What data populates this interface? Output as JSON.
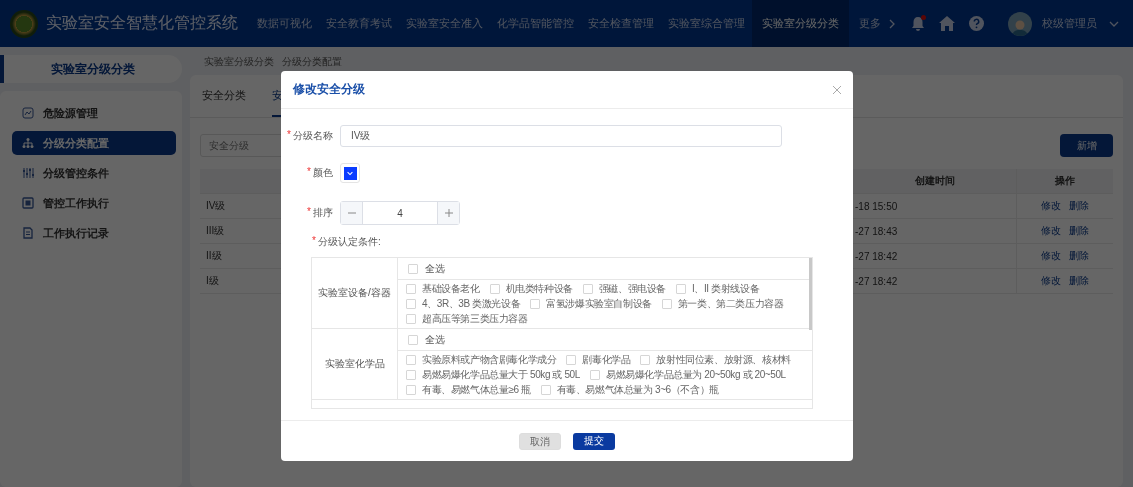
{
  "header": {
    "title": "实验室安全智慧化管控系统",
    "nav": [
      {
        "label": "数据可视化",
        "selected": false
      },
      {
        "label": "安全教育考试",
        "selected": false
      },
      {
        "label": "实验室安全准入",
        "selected": false
      },
      {
        "label": "化学品智能管控",
        "selected": false
      },
      {
        "label": "安全检查管理",
        "selected": false
      },
      {
        "label": "实验室综合管理",
        "selected": false
      },
      {
        "label": "实验室分级分类",
        "selected": true
      }
    ],
    "more": "更多",
    "notifications": true,
    "user": "校级管理员"
  },
  "sidebar": {
    "title": "实验室分级分类",
    "items": [
      {
        "label": "危险源管理",
        "selected": false
      },
      {
        "label": "分级分类配置",
        "selected": true
      },
      {
        "label": "分级管控条件",
        "selected": false
      },
      {
        "label": "管控工作执行",
        "selected": false
      },
      {
        "label": "工作执行记录",
        "selected": false
      }
    ]
  },
  "breadcrumb": [
    "实验室分级分类",
    "分级分类配置"
  ],
  "tabs": [
    {
      "label": "安全分类",
      "selected": false
    },
    {
      "label": "安",
      "selected": true
    }
  ],
  "search": {
    "placeholder": "安全分级"
  },
  "new_button": "新增",
  "table": {
    "columns": [
      "创建时间",
      "操作"
    ],
    "rows": [
      {
        "name": "IV级",
        "created": "-18 15:50",
        "actions": [
          "修改",
          "删除"
        ]
      },
      {
        "name": "III级",
        "created": "-27 18:43",
        "actions": [
          "修改",
          "删除"
        ]
      },
      {
        "name": "II级",
        "created": "-27 18:42",
        "actions": [
          "修改",
          "删除"
        ]
      },
      {
        "name": "I级",
        "created": "-27 18:42",
        "actions": [
          "修改",
          "删除"
        ]
      }
    ]
  },
  "dialog": {
    "title": "修改安全分级",
    "fields": [
      {
        "kind": "text",
        "required_mark": "*",
        "label": "分级名称",
        "value": "IV级"
      },
      {
        "kind": "color",
        "required_mark": "*",
        "label": "颜色",
        "color": "#0a3cff"
      },
      {
        "kind": "stepper",
        "required_mark": "*",
        "label": "排序",
        "value": "4"
      }
    ],
    "conditions": {
      "required_mark": "*",
      "label": "分级认定条件:",
      "groups": [
        {
          "name": "实验室设备/容器",
          "select_all": {
            "label": "全选",
            "checked": false
          },
          "items": [
            {
              "label": "基础设备老化",
              "checked": false
            },
            {
              "label": "机电类特种设备",
              "checked": false
            },
            {
              "label": "强磁、强电设备",
              "checked": false
            },
            {
              "label": "I、II 类射线设备",
              "checked": false
            },
            {
              "label": "4、3R、3B 类激光设备",
              "checked": false
            },
            {
              "label": "富氢涉爆实验室自制设备",
              "checked": false
            },
            {
              "label": "第一类、第二类压力容器",
              "checked": false
            },
            {
              "label": "超高压等第三类压力容器",
              "checked": false
            }
          ]
        },
        {
          "name": "实验室化学品",
          "select_all": {
            "label": "全选",
            "checked": false
          },
          "items": [
            {
              "label": "实验原料或产物含剧毒化学成分",
              "checked": false
            },
            {
              "label": "剧毒化学品",
              "checked": false
            },
            {
              "label": "放射性同位素、放射源、核材料",
              "checked": false
            },
            {
              "label": "易燃易爆化学品总量大于 50kg 或 50L",
              "checked": false
            },
            {
              "label": "易燃易爆化学品总量为 20~50kg 或 20~50L",
              "checked": false
            },
            {
              "label": "有毒、易燃气体总量≥6 瓶",
              "checked": false
            },
            {
              "label": "有毒、易燃气体总量为 3~6（不含）瓶",
              "checked": false
            }
          ]
        }
      ]
    },
    "buttons": [
      {
        "label": "取消",
        "kind": "cancel",
        "disabled": true
      },
      {
        "label": "提交",
        "kind": "submit",
        "disabled": false
      }
    ]
  }
}
